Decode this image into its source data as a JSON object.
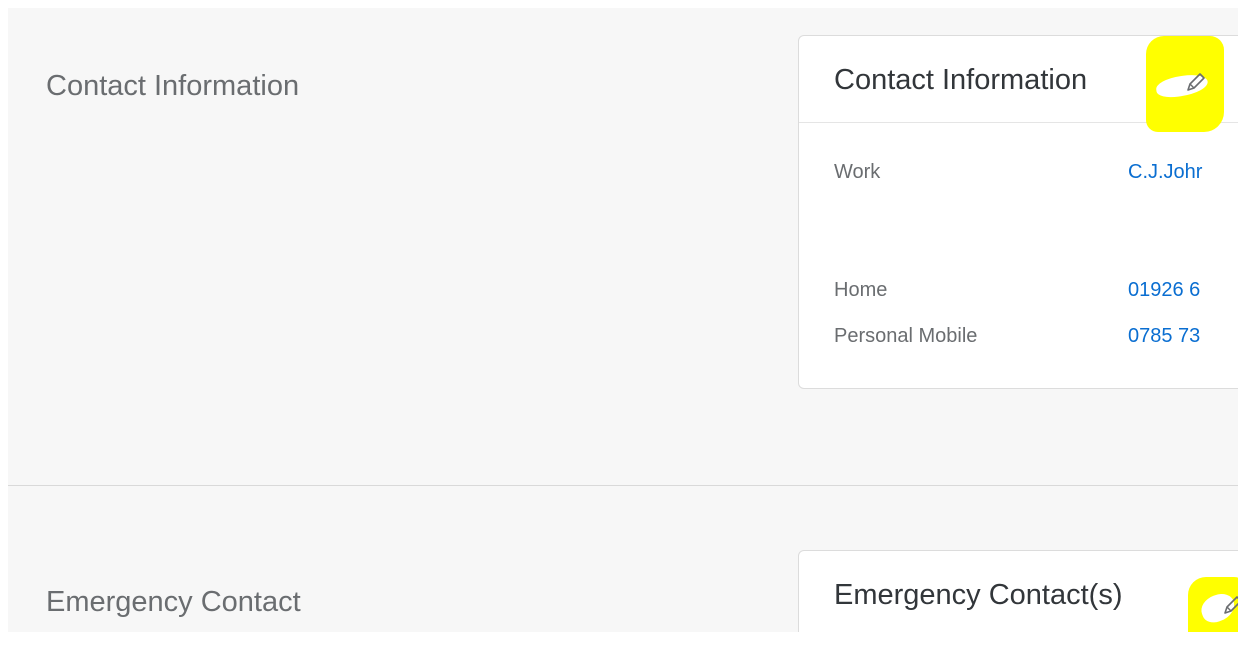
{
  "contact_section": {
    "title": "Contact Information",
    "card": {
      "title": "Contact Information",
      "edit_icon": "pencil-icon",
      "fields": [
        {
          "label": "Work",
          "value": "C.J.Johr"
        },
        {
          "label": "Home",
          "value": "01926 6"
        },
        {
          "label": "Personal Mobile",
          "value": "0785 73"
        }
      ]
    }
  },
  "emergency_section": {
    "title": "Emergency Contact",
    "card": {
      "title": "Emergency Contact(s)",
      "edit_icon": "pencil-icon"
    }
  },
  "colors": {
    "page_background": "#f7f7f7",
    "card_background": "#ffffff",
    "link": "#0a6ed1",
    "label": "#6a6d70",
    "highlight": "#ffff00"
  }
}
